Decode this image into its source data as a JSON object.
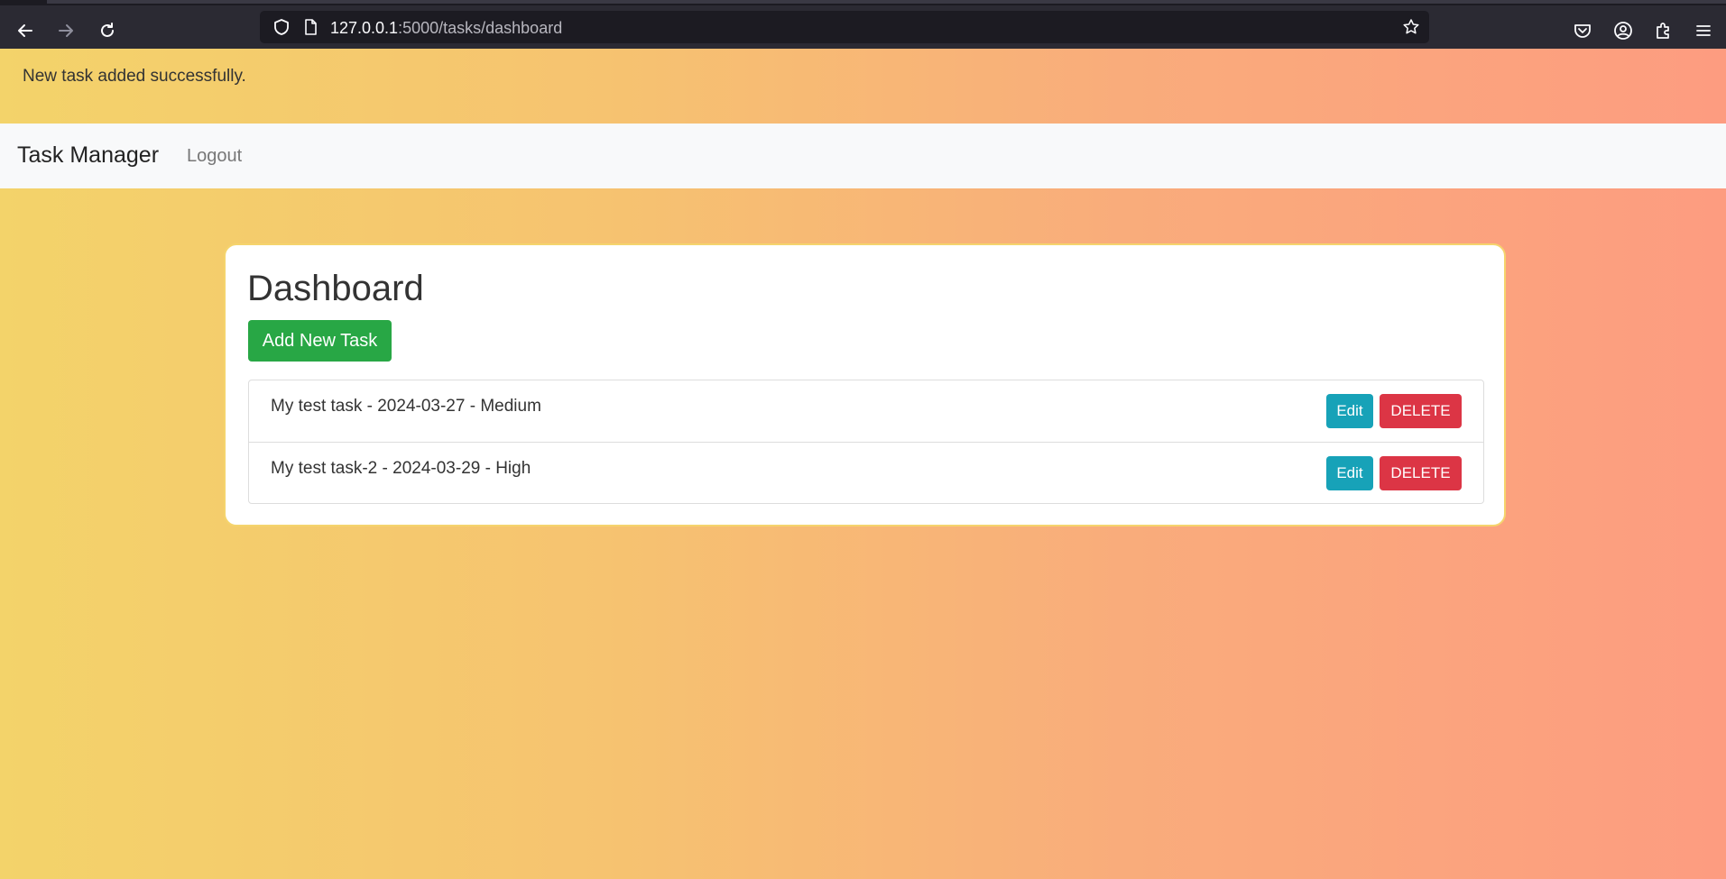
{
  "browser": {
    "url_host": "127.0.0.1",
    "url_rest": ":5000/tasks/dashboard",
    "icons": [
      "back-icon",
      "forward-icon",
      "reload-icon",
      "shield-icon",
      "page-icon",
      "bookmark-star-icon",
      "pocket-icon",
      "account-icon",
      "extensions-icon",
      "menu-icon"
    ]
  },
  "flash": {
    "message": "New task added successfully."
  },
  "navbar": {
    "brand": "Task Manager",
    "logout_label": "Logout"
  },
  "dashboard": {
    "title": "Dashboard",
    "add_button_label": "Add New Task",
    "tasks": [
      {
        "text": "My test task - 2024-03-27 - Medium",
        "edit_label": "Edit",
        "delete_label": "DELETE"
      },
      {
        "text": "My test task-2 - 2024-03-29 - High",
        "edit_label": "Edit",
        "delete_label": "DELETE"
      }
    ]
  },
  "colors": {
    "success": "#28a745",
    "info": "#17a2b8",
    "danger": "#dc3545",
    "gradient_start": "#f3d36a",
    "gradient_end": "#fd9c80"
  }
}
